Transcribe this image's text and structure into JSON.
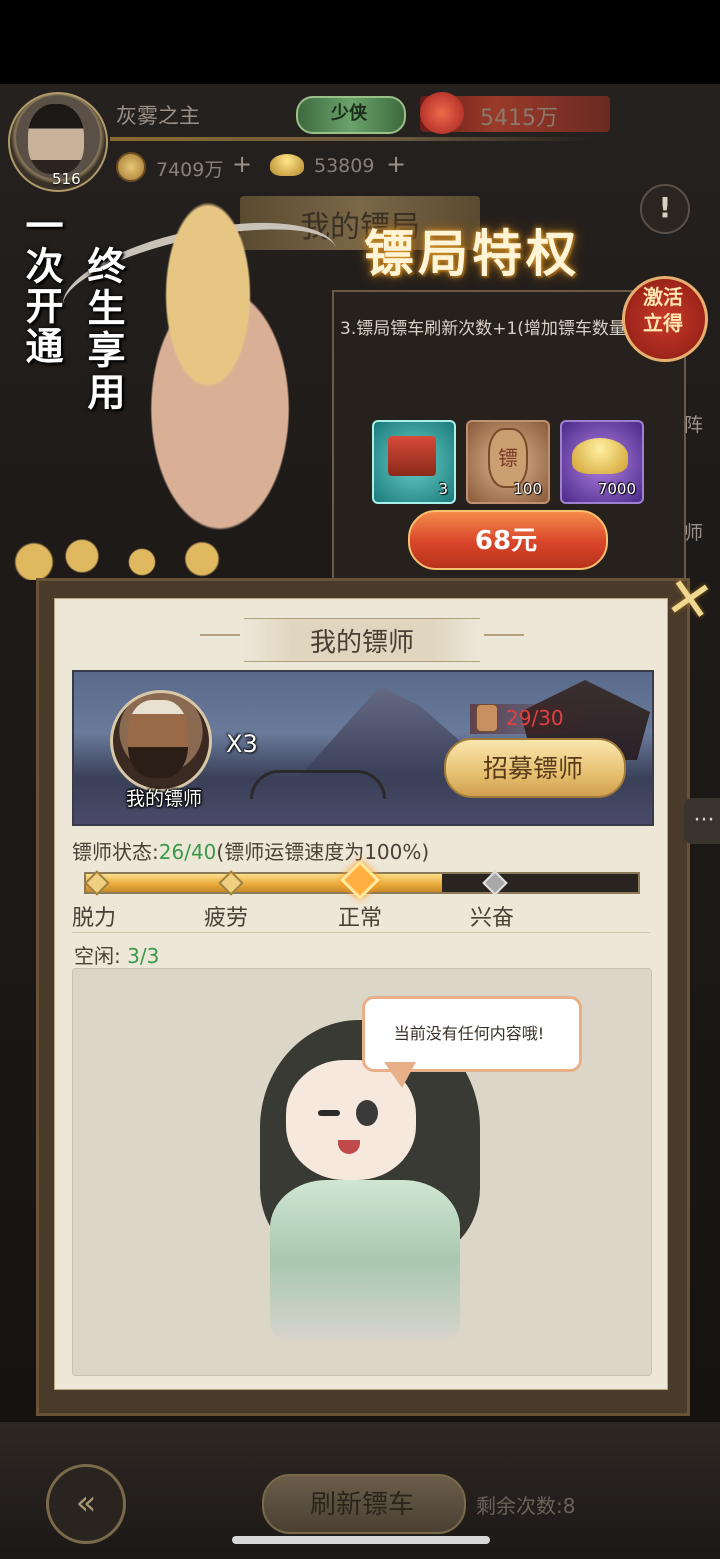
{
  "header": {
    "player_name": "灰雾之主",
    "player_level": "516",
    "rank_badge": "少侠",
    "power": "5415万",
    "copper": "7409万",
    "gold": "53809",
    "plus": "+",
    "warning_icon": "!"
  },
  "background_title": "我的镖局",
  "promo": {
    "left_text": "一次开通",
    "right_text": "终生享用",
    "title": "镖局特权",
    "activate_badge": "激活\n立得",
    "description": "3.镖局镖车刷新次数+1(增加镖车数量)",
    "items": [
      {
        "name": "chest-item",
        "count": "3"
      },
      {
        "name": "escort-token-item",
        "count": "100"
      },
      {
        "name": "gold-ingot-item",
        "count": "7000"
      }
    ],
    "item_glyph": "镖",
    "price": "68元"
  },
  "side_tabs": [
    "阵",
    "师"
  ],
  "close_icon": "✕",
  "main": {
    "title": "我的镖师",
    "escort": {
      "label": "我的镖师",
      "multiplier": "X3",
      "tickets": "29/30",
      "recruit_label": "招募镖师"
    },
    "status": {
      "prefix": "镖师状态:",
      "value": "26/40",
      "suffix": "(镖师运镖速度为100%)",
      "fraction": 0.65
    },
    "bar_labels": [
      "脱力",
      "疲劳",
      "正常",
      "兴奋"
    ],
    "idle": {
      "prefix": "空闲:",
      "value": "3/3"
    },
    "empty_message": "当前没有任何内容哦!"
  },
  "bottom": {
    "back_icon": "«",
    "refresh_label": "刷新镖车",
    "remaining_prefix": "剩余次数:",
    "remaining_value": "8"
  },
  "colors": {
    "accent_green": "#3a9a4a",
    "ticket_red": "#e04040",
    "price_orange": "#d8452a",
    "bar_gold": "#e8a838"
  }
}
